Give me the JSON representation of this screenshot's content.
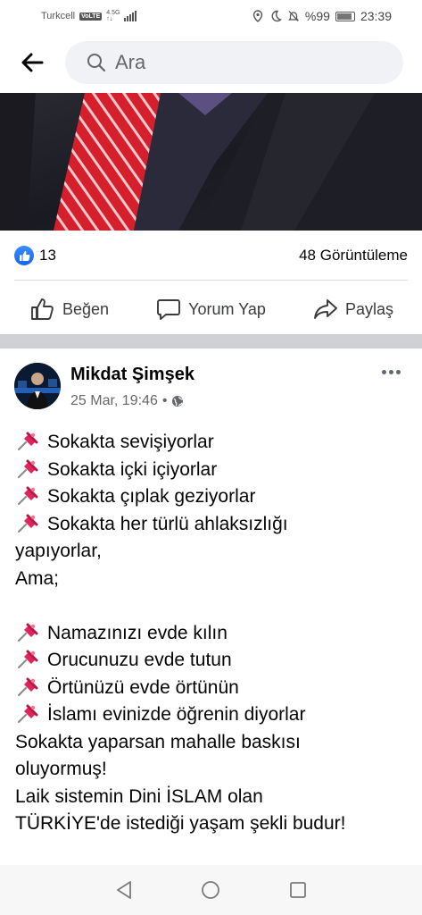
{
  "status_bar": {
    "carrier": "Turkcell",
    "volte": "VoLTE",
    "network_top": "4.5G",
    "network_bottom": "↑↓",
    "battery": "%99",
    "time": "23:39"
  },
  "search": {
    "placeholder": "Ara"
  },
  "reactions": {
    "count": "13",
    "views": "48 Görüntüleme"
  },
  "actions": {
    "like": "Beğen",
    "comment": "Yorum Yap",
    "share": "Paylaş"
  },
  "post": {
    "author": "Mikdat Şimşek",
    "time": "25 Mar, 19:46",
    "separator": "•",
    "lines": [
      {
        "pin": true,
        "text": "Sokakta sevişiyorlar"
      },
      {
        "pin": true,
        "text": "Sokakta içki içiyorlar"
      },
      {
        "pin": true,
        "text": "Sokakta çıplak geziyorlar"
      },
      {
        "pin": true,
        "text": "Sokakta her türlü ahlaksızlığı"
      },
      {
        "pin": false,
        "text": "yapıyorlar,"
      },
      {
        "pin": false,
        "text": "Ama;"
      },
      {
        "pin": false,
        "text": ""
      },
      {
        "pin": true,
        "text": "Namazınızı evde kılın"
      },
      {
        "pin": true,
        "text": "Orucunuzu evde tutun"
      },
      {
        "pin": true,
        "text": "Örtünüzü evde örtünün"
      },
      {
        "pin": true,
        "text": "İslamı evinizde öğrenin diyorlar"
      },
      {
        "pin": false,
        "text": "Sokakta yaparsan mahalle baskısı"
      },
      {
        "pin": false,
        "text": "oluyormuş!"
      },
      {
        "pin": false,
        "text": "Laik sistemin Dini İSLAM olan"
      },
      {
        "pin": false,
        "text": "TÜRKİYE'de istediği yaşam şekli budur!"
      }
    ]
  },
  "colors": {
    "accent": "#1877f2",
    "pin": "#e0245e"
  }
}
